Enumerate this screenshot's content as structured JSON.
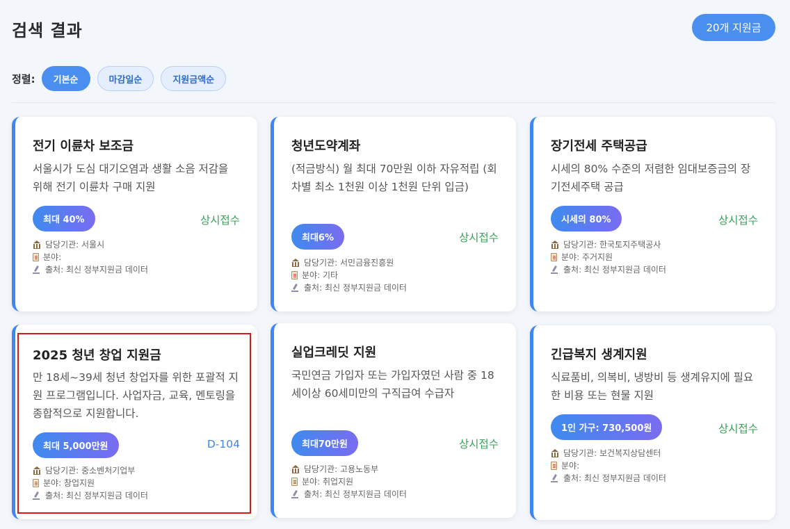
{
  "header": {
    "title": "검색 결과",
    "count_badge": "20개 지원금"
  },
  "sort": {
    "label": "정렬:",
    "options": [
      {
        "label": "기본순",
        "active": true
      },
      {
        "label": "마감일순",
        "active": false
      },
      {
        "label": "지원금액순",
        "active": false
      }
    ]
  },
  "meta_labels": {
    "agency": "담당기관",
    "field": "분야",
    "source": "출처"
  },
  "cards": [
    {
      "title": "전기 이륜차 보조금",
      "desc": "서울시가 도심 대기오염과 생활 소음 저감을 위해 전기 이륜차 구매 지원",
      "amount": "최대 40%",
      "status": "상시접수",
      "agency": "담당기관: 서울시",
      "field": "분야:",
      "source": "출처: 최신 정부지원금 데이터"
    },
    {
      "title": "청년도약계좌",
      "desc": "(적금방식) 월 최대 70만원 이하 자유적립 (회차별 최소 1천원 이상 1천원 단위 입금)",
      "amount": "최대6%",
      "status": "상시접수",
      "agency": "담당기관: 서민금융진흥원",
      "field": "분야: 기타",
      "source": "출처: 최신 정부지원금 데이터"
    },
    {
      "title": "장기전세 주택공급",
      "desc": "시세의 80% 수준의 저렴한 임대보증금의 장기전세주택 공급",
      "amount": "시세의 80%",
      "status": "상시접수",
      "agency": "담당기관: 한국토지주택공사",
      "field": "분야: 주거지원",
      "source": "출처: 최신 정부지원금 데이터"
    },
    {
      "title": "2025 청년 창업 지원금",
      "desc": "만 18세~39세 청년 창업자를 위한 포괄적 지원 프로그램입니다. 사업자금, 교육, 멘토링을 종합적으로 지원합니다.",
      "amount": "최대 5,000만원",
      "status": "D-104",
      "agency": "담당기관: 중소벤처기업부",
      "field": "분야: 창업지원",
      "source": "출처: 최신 정부지원금 데이터"
    },
    {
      "title": "실업크레딧 지원",
      "desc": "국민연금 가입자 또는 가입자였던 사람 중 18세이상 60세미만의 구직급여 수급자",
      "amount": "최대70만원",
      "status": "상시접수",
      "agency": "담당기관: 고용노동부",
      "field": "분야: 취업지원",
      "source": "출처: 최신 정부지원금 데이터"
    },
    {
      "title": "긴급복지 생계지원",
      "desc": "식료품비, 의복비, 냉방비 등 생계유지에 필요한 비용 또는 현물 지원",
      "amount": "1인 가구: 730,500원",
      "status": "상시접수",
      "agency": "담당기관: 보건복지상담센터",
      "field": "분야:",
      "source": "출처: 최신 정부지원금 데이터"
    }
  ]
}
